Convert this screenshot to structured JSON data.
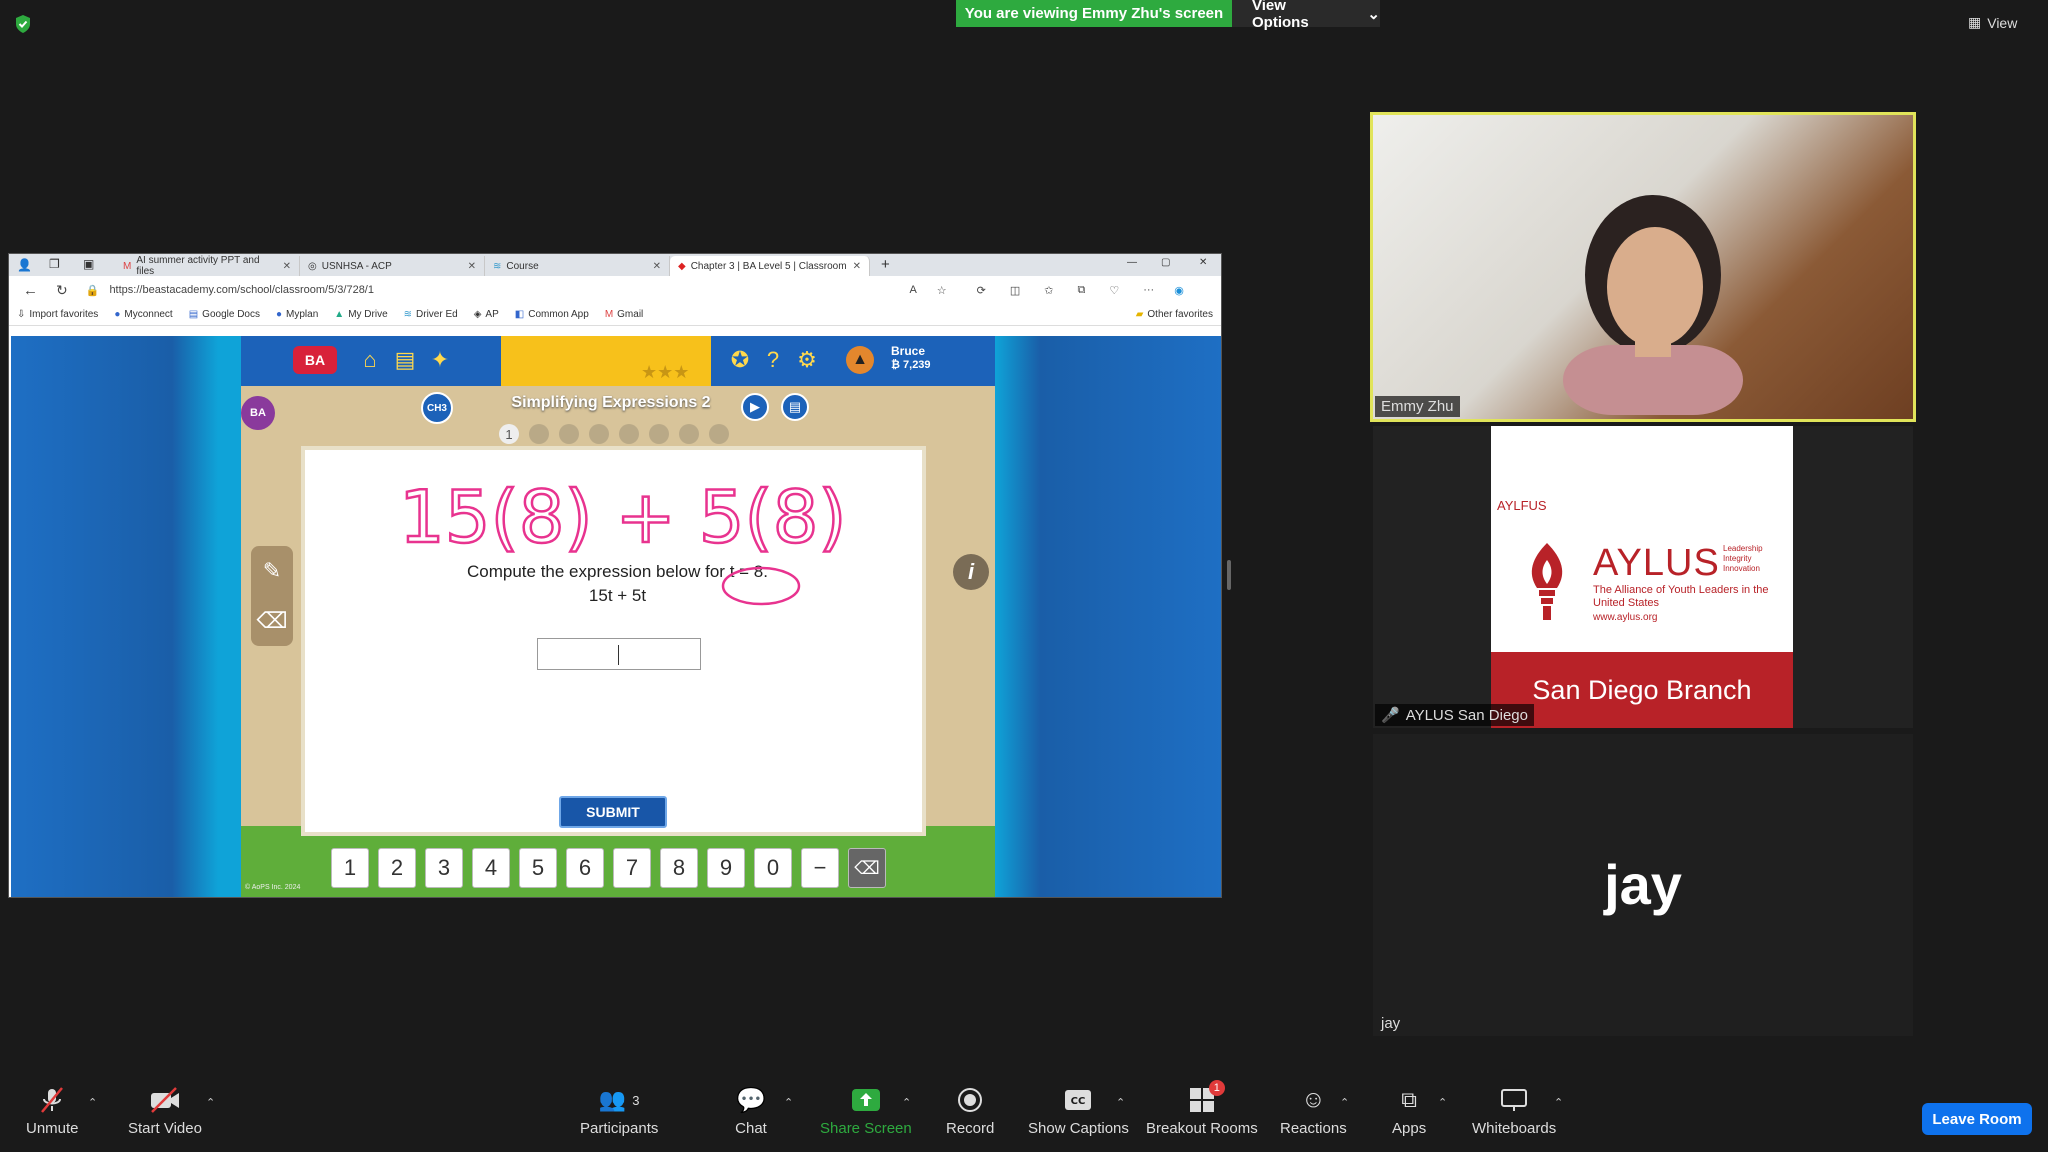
{
  "banner": {
    "viewing_text": "You are viewing Emmy Zhu's screen",
    "view_options_label": "View Options"
  },
  "view_label": "View",
  "browser": {
    "tabs": [
      {
        "label": "AI summer activity PPT and files"
      },
      {
        "label": "USNHSA - ACP"
      },
      {
        "label": "Course"
      },
      {
        "label": "Chapter 3 | BA Level 5 | Classroom"
      }
    ],
    "url": "https://beastacademy.com/school/classroom/5/3/728/1",
    "favorites": [
      "Import favorites",
      "Myconnect",
      "Google Docs",
      "Myplan",
      "My Drive",
      "Driver Ed",
      "AP",
      "Common App",
      "Gmail"
    ],
    "other_favorites": "Other favorites"
  },
  "game": {
    "lesson_title": "Simplifying Expressions 2",
    "chapter_badge": "CH3",
    "user_name": "Bruce",
    "user_points": "₿ 7,239",
    "question": "Compute the expression below for t = 8.",
    "expression": "15t + 5t",
    "handwriting": "15(8) + 5(8)",
    "submit_label": "SUBMIT",
    "keys": [
      "1",
      "2",
      "3",
      "4",
      "5",
      "6",
      "7",
      "8",
      "9",
      "0",
      "−",
      "⌫"
    ],
    "copyright": "© AoPS Inc. 2024",
    "progress_dots": [
      "1",
      "",
      "",
      "",
      "",
      "",
      "",
      ""
    ]
  },
  "participants": [
    {
      "name": "Emmy Zhu"
    },
    {
      "name": "AYLUS San Diego"
    },
    {
      "name": "jay",
      "display_initial": "jay"
    }
  ],
  "aylus": {
    "small_logo": "AYLFUS",
    "title": "AYLUS",
    "tagline": [
      "Leadership",
      "Integrity",
      "Innovation"
    ],
    "subtitle": "The Alliance of Youth Leaders in the United States",
    "url": "www.aylus.org",
    "branch": "San Diego Branch"
  },
  "toolbar": {
    "unmute": "Unmute",
    "start_video": "Start Video",
    "participants": "Participants",
    "participants_count": "3",
    "chat": "Chat",
    "share_screen": "Share Screen",
    "record": "Record",
    "captions": "Show Captions",
    "breakout": "Breakout Rooms",
    "breakout_badge": "1",
    "reactions": "Reactions",
    "apps": "Apps",
    "whiteboards": "Whiteboards",
    "leave": "Leave Room"
  },
  "colors": {
    "banner_green": "#2eaa3f",
    "active_speaker": "#e1e45a",
    "leave_blue": "#0e72ed",
    "ink_pink": "#e8338f"
  }
}
